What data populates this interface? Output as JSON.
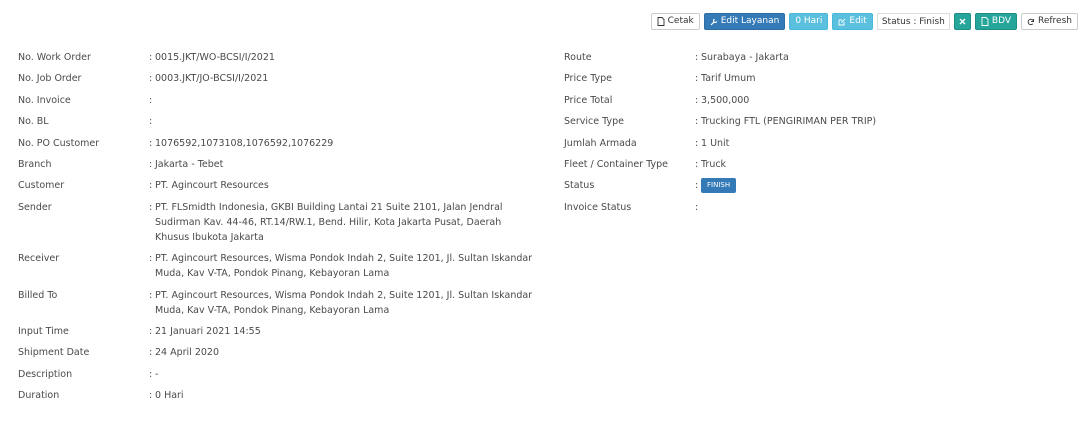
{
  "toolbar": {
    "cetak": "Cetak",
    "edit_layanan": "Edit Layanan",
    "hari": "0 Hari",
    "edit": "Edit",
    "status": "Status : Finish",
    "bdv": "BDV",
    "refresh": "Refresh"
  },
  "colors": {
    "primary": "#337ab7",
    "info": "#5bc0de",
    "success": "#26a69a"
  },
  "left": [
    {
      "label": "No. Work Order",
      "value": "0015.JKT/WO-BCSI/I/2021"
    },
    {
      "label": "No. Job Order",
      "value": "0003.JKT/JO-BCSI/I/2021"
    },
    {
      "label": "No. Invoice",
      "value": ""
    },
    {
      "label": "No. BL",
      "value": ""
    },
    {
      "label": "No. PO Customer",
      "value": "1076592,1073108,1076592,1076229"
    },
    {
      "label": "Branch",
      "value": "Jakarta - Tebet"
    },
    {
      "label": "Customer",
      "value": "PT. Agincourt Resources"
    },
    {
      "label": "Sender",
      "value": "PT. FLSmidth Indonesia, GKBI Building Lantai 21 Suite 2101, Jalan Jendral Sudirman Kav. 44-46, RT.14/RW.1, Bend. Hilir, Kota Jakarta Pusat, Daerah Khusus Ibukota Jakarta"
    },
    {
      "label": "Receiver",
      "value": "PT. Agincourt Resources, Wisma Pondok Indah 2, Suite 1201, Jl. Sultan Iskandar Muda, Kav V-TA, Pondok Pinang, Kebayoran Lama"
    },
    {
      "label": "Billed To",
      "value": "PT. Agincourt Resources, Wisma Pondok Indah 2, Suite 1201, Jl. Sultan Iskandar Muda, Kav V-TA, Pondok Pinang, Kebayoran Lama"
    },
    {
      "label": "Input Time",
      "value": "21 Januari 2021 14:55"
    },
    {
      "label": "Shipment Date",
      "value": "24 April 2020"
    },
    {
      "label": "Description",
      "value": "-"
    },
    {
      "label": "Duration",
      "value": "0 Hari"
    }
  ],
  "right": [
    {
      "label": "Route",
      "value": "Surabaya - Jakarta"
    },
    {
      "label": "Price Type",
      "value": "Tarif Umum"
    },
    {
      "label": "Price Total",
      "value": "3,500,000"
    },
    {
      "label": "Service Type",
      "value": "Trucking FTL (PENGIRIMAN PER TRIP)"
    },
    {
      "label": "Jumlah Armada",
      "value": "1 Unit"
    },
    {
      "label": "Fleet / Container Type",
      "value": "Truck"
    },
    {
      "label": "Status",
      "value": "FINISH",
      "badge": true
    },
    {
      "label": "Invoice Status",
      "value": ""
    }
  ]
}
